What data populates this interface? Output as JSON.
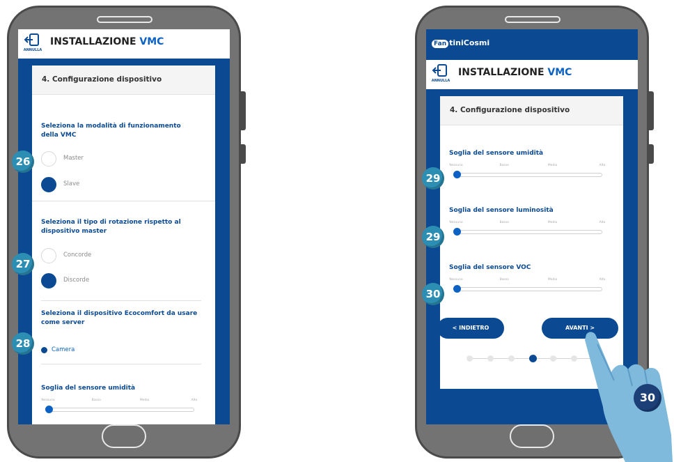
{
  "left_phone": {
    "header": {
      "cancel_label": "ANNULLA",
      "title_main": "INSTALLAZIONE ",
      "title_accent": "VMC"
    },
    "card_title": "4. Configurazione dispositivo",
    "mode_question": "Seleziona la modalità di funzionamento della VMC",
    "mode_options": [
      {
        "label": "Master",
        "selected": false
      },
      {
        "label": "Slave",
        "selected": true
      }
    ],
    "rotation_question": "Seleziona il tipo di rotazione rispetto al dispositivo master",
    "rotation_options": [
      {
        "label": "Concorde",
        "selected": false
      },
      {
        "label": "Discorde",
        "selected": true
      }
    ],
    "server_question": "Seleziona il dispositivo Ecocomfort da usare come server",
    "server_option": "Camera",
    "humidity_slider": {
      "title": "Soglia del sensore umidità",
      "scale": [
        "Nessuno",
        "Basso",
        "Medio",
        "Alto"
      ],
      "level": 0
    },
    "badges": [
      "26",
      "27",
      "28"
    ]
  },
  "right_phone": {
    "logo": {
      "fan": "Fan",
      "rest": "tiniCosmi"
    },
    "header": {
      "cancel_label": "ANNULLA",
      "title_main": "INSTALLAZIONE ",
      "title_accent": "VMC"
    },
    "card_title": "4. Configurazione dispositivo",
    "sliders": [
      {
        "title": "Soglia del sensore umidità",
        "scale": [
          "Nessuno",
          "Basso",
          "Medio",
          "Alto"
        ],
        "level": 0,
        "badge": "29"
      },
      {
        "title": "Soglia del sensore luminosità",
        "scale": [
          "Nessuno",
          "Basso",
          "Medio",
          "Alto"
        ],
        "level": 0,
        "badge": "29"
      },
      {
        "title": "Soglia del sensore VOC",
        "scale": [
          "Nessuno",
          "Basso",
          "Medio",
          "Alto"
        ],
        "level": 0,
        "badge": "30"
      }
    ],
    "back_button": "< INDIETRO",
    "next_button": "AVANTI >",
    "steps": {
      "total": 7,
      "current": 4
    },
    "tap_badge": "30"
  },
  "colors": {
    "brand_blue": "#0b4a93",
    "accent_blue": "#0b62c4",
    "badge_teal": "#2d8eb3",
    "phone_gray": "#737373"
  }
}
